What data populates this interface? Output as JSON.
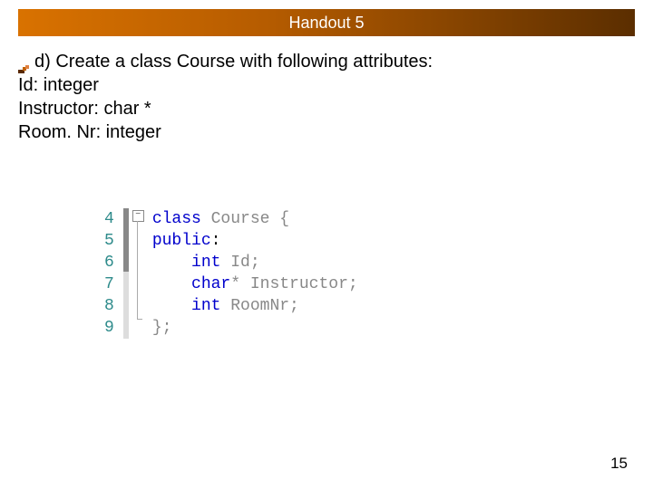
{
  "header": {
    "title": "Handout 5"
  },
  "body": {
    "bullet_line": "d) Create a class Course with following attributes:",
    "lines": [
      "Id: integer",
      "Instructor: char *",
      "Room. Nr: integer"
    ]
  },
  "code": {
    "line_numbers": [
      "4",
      "5",
      "6",
      "7",
      "8",
      "9"
    ],
    "tokens": {
      "l1_kw": "class",
      "l1_rest": " Course {",
      "l2_kw": "public",
      "l2_rest": ":",
      "l3_kw": "int",
      "l3_rest": " Id;",
      "l4_kw": "char",
      "l4_rest": "* Instructor;",
      "l5_kw": "int",
      "l5_rest": " RoomNr;",
      "l6": "};"
    }
  },
  "page_number": "15"
}
